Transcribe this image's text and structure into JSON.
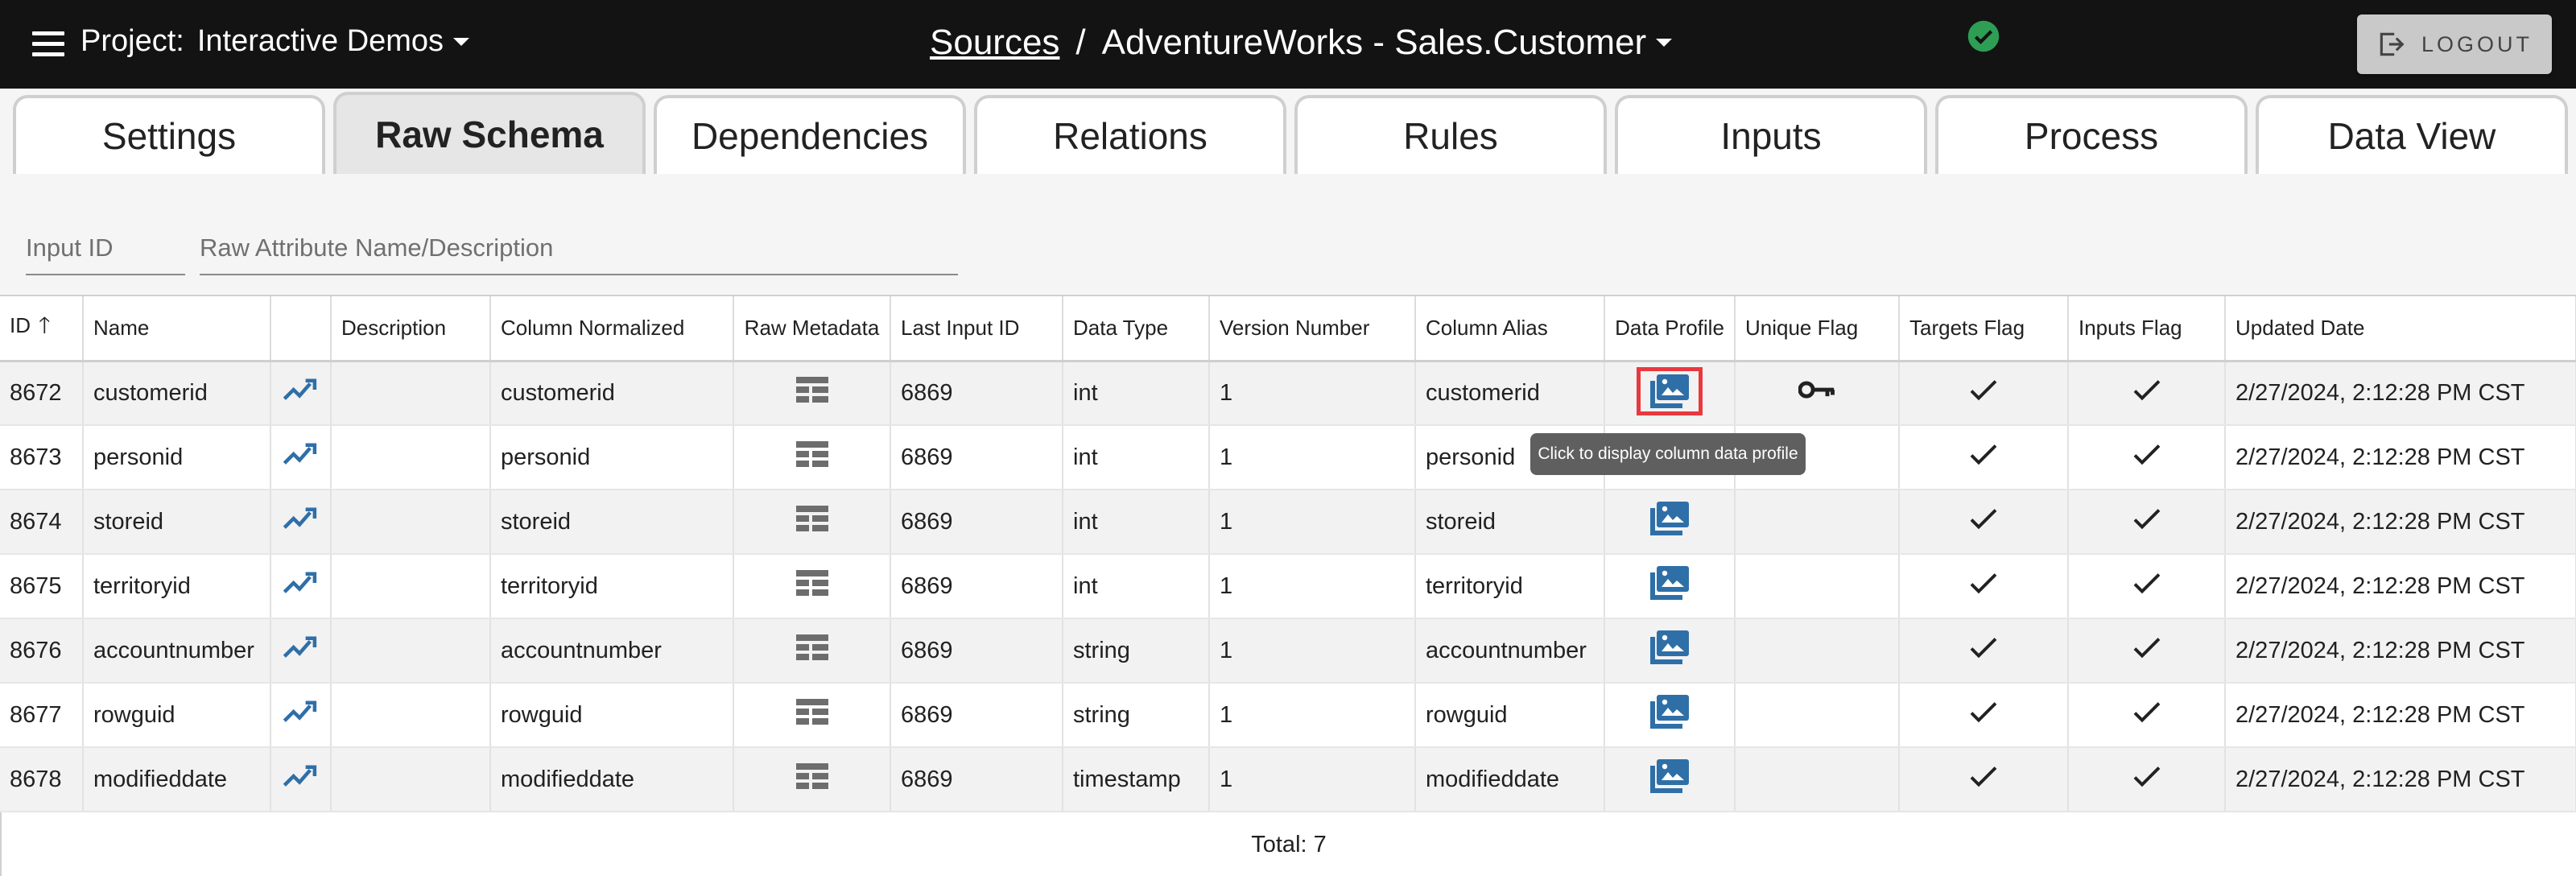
{
  "header": {
    "project_label": "Project:",
    "project_name": "Interactive Demos",
    "breadcrumb_root": "Sources",
    "breadcrumb_sep": "/",
    "breadcrumb_current": "AdventureWorks - Sales.Customer",
    "status_color": "#2e9e55",
    "logout_label": "LOGOUT"
  },
  "tabs": [
    {
      "label": "Settings",
      "active": false
    },
    {
      "label": "Raw Schema",
      "active": true
    },
    {
      "label": "Dependencies",
      "active": false
    },
    {
      "label": "Relations",
      "active": false
    },
    {
      "label": "Rules",
      "active": false
    },
    {
      "label": "Inputs",
      "active": false
    },
    {
      "label": "Process",
      "active": false
    },
    {
      "label": "Data View",
      "active": false
    }
  ],
  "filters": {
    "input_id_placeholder": "Input ID",
    "attr_placeholder": "Raw Attribute Name/Description"
  },
  "table": {
    "headers": [
      "ID",
      "Name",
      "",
      "Description",
      "Column Normalized",
      "Raw Metadata",
      "Last Input ID",
      "Data Type",
      "Version Number",
      "Column Alias",
      "Data Profile",
      "Unique Flag",
      "Targets Flag",
      "Inputs Flag",
      "Updated Date"
    ],
    "sort_arrow": "🡑",
    "rows": [
      {
        "id": "8672",
        "name": "customerid",
        "description": "",
        "normalized": "customerid",
        "last_input": "6869",
        "type": "int",
        "version": "1",
        "alias": "customerid",
        "unique": true,
        "targets": true,
        "inputs": true,
        "updated": "2/27/2024, 2:12:28 PM CST"
      },
      {
        "id": "8673",
        "name": "personid",
        "description": "",
        "normalized": "personid",
        "last_input": "6869",
        "type": "int",
        "version": "1",
        "alias": "personid",
        "unique": false,
        "targets": true,
        "inputs": true,
        "updated": "2/27/2024, 2:12:28 PM CST"
      },
      {
        "id": "8674",
        "name": "storeid",
        "description": "",
        "normalized": "storeid",
        "last_input": "6869",
        "type": "int",
        "version": "1",
        "alias": "storeid",
        "unique": false,
        "targets": true,
        "inputs": true,
        "updated": "2/27/2024, 2:12:28 PM CST"
      },
      {
        "id": "8675",
        "name": "territoryid",
        "description": "",
        "normalized": "territoryid",
        "last_input": "6869",
        "type": "int",
        "version": "1",
        "alias": "territoryid",
        "unique": false,
        "targets": true,
        "inputs": true,
        "updated": "2/27/2024, 2:12:28 PM CST"
      },
      {
        "id": "8676",
        "name": "accountnumber",
        "description": "",
        "normalized": "accountnumber",
        "last_input": "6869",
        "type": "string",
        "version": "1",
        "alias": "accountnumber",
        "unique": false,
        "targets": true,
        "inputs": true,
        "updated": "2/27/2024, 2:12:28 PM CST"
      },
      {
        "id": "8677",
        "name": "rowguid",
        "description": "",
        "normalized": "rowguid",
        "last_input": "6869",
        "type": "string",
        "version": "1",
        "alias": "rowguid",
        "unique": false,
        "targets": true,
        "inputs": true,
        "updated": "2/27/2024, 2:12:28 PM CST"
      },
      {
        "id": "8678",
        "name": "modifieddate",
        "description": "",
        "normalized": "modifieddate",
        "last_input": "6869",
        "type": "timestamp",
        "version": "1",
        "alias": "modifieddate",
        "unique": false,
        "targets": true,
        "inputs": true,
        "updated": "2/27/2024, 2:12:28 PM CST"
      }
    ],
    "total": "Total: 7"
  },
  "tooltip": "Click to display column data profile",
  "icons": {
    "menu": "menu-icon",
    "status": "check-circle-icon",
    "logout": "logout-icon",
    "trend": "trending-up-icon",
    "metadata": "table-icon",
    "profile": "photo-library-icon",
    "unique": "key-icon",
    "flag": "check-icon"
  },
  "colors": {
    "accent_blue": "#2f6fa8",
    "highlight_red": "#e8393f"
  }
}
